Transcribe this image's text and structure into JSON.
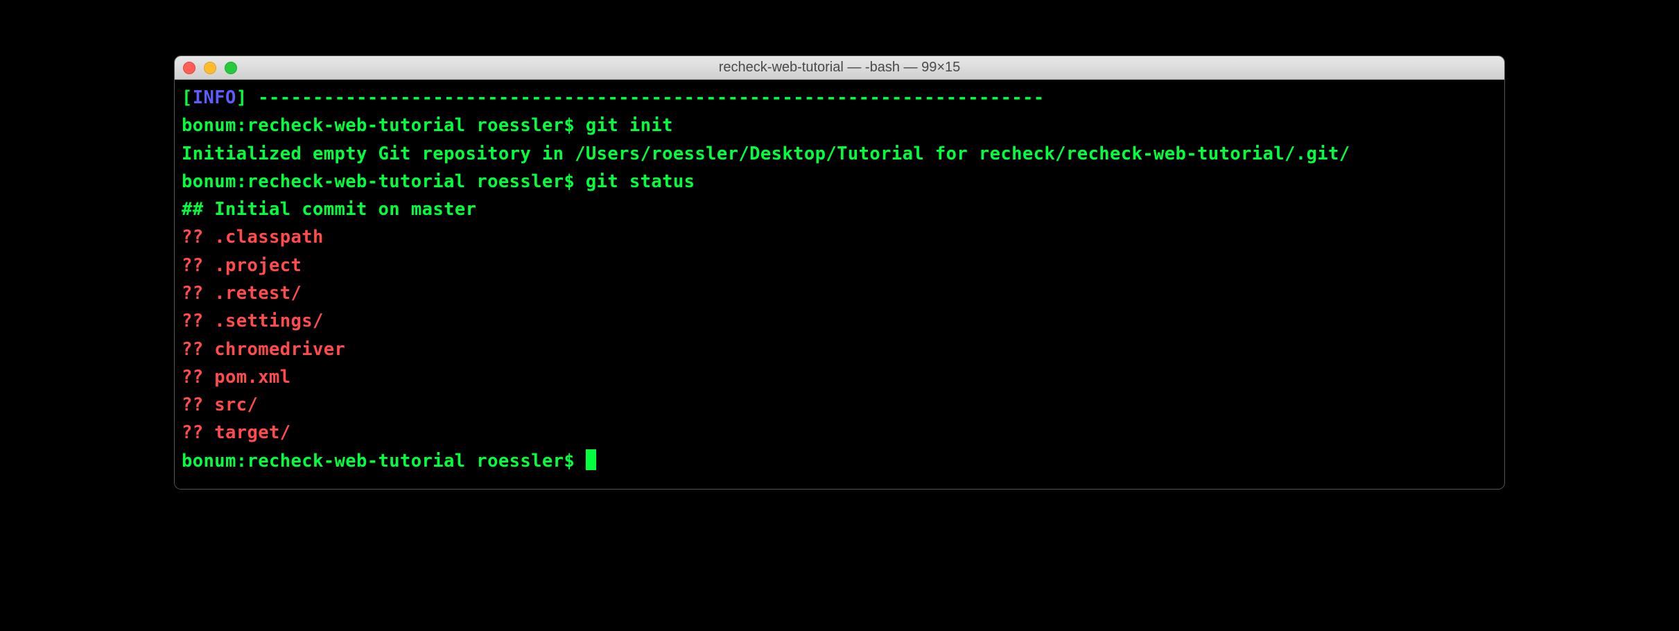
{
  "window": {
    "title": "recheck-web-tutorial — -bash — 99×15"
  },
  "terminal": {
    "info_bracket_open": "[",
    "info_label": "INFO",
    "info_bracket_close": "] ",
    "dashes": "------------------------------------------------------------------------",
    "prompt1_host": "bonum:",
    "prompt1_dir": "recheck-web-tutorial",
    "prompt1_user": " roessler$ ",
    "cmd1": "git init",
    "output1": "Initialized empty Git repository in /Users/roessler/Desktop/Tutorial for recheck/recheck-web-tutorial/.git/",
    "prompt2_host": "bonum:",
    "prompt2_dir": "recheck-web-tutorial",
    "prompt2_user": " roessler$ ",
    "cmd2": "git status",
    "status_hashes": "## ",
    "status_text": "Initial commit on ",
    "status_branch": "master",
    "untracked": [
      {
        "marker": "?? ",
        "file": ".classpath"
      },
      {
        "marker": "?? ",
        "file": ".project"
      },
      {
        "marker": "?? ",
        "file": ".retest/"
      },
      {
        "marker": "?? ",
        "file": ".settings/"
      },
      {
        "marker": "?? ",
        "file": "chromedriver"
      },
      {
        "marker": "?? ",
        "file": "pom.xml"
      },
      {
        "marker": "?? ",
        "file": "src/"
      },
      {
        "marker": "?? ",
        "file": "target/"
      }
    ],
    "prompt3": "bonum:recheck-web-tutorial roessler$ "
  }
}
